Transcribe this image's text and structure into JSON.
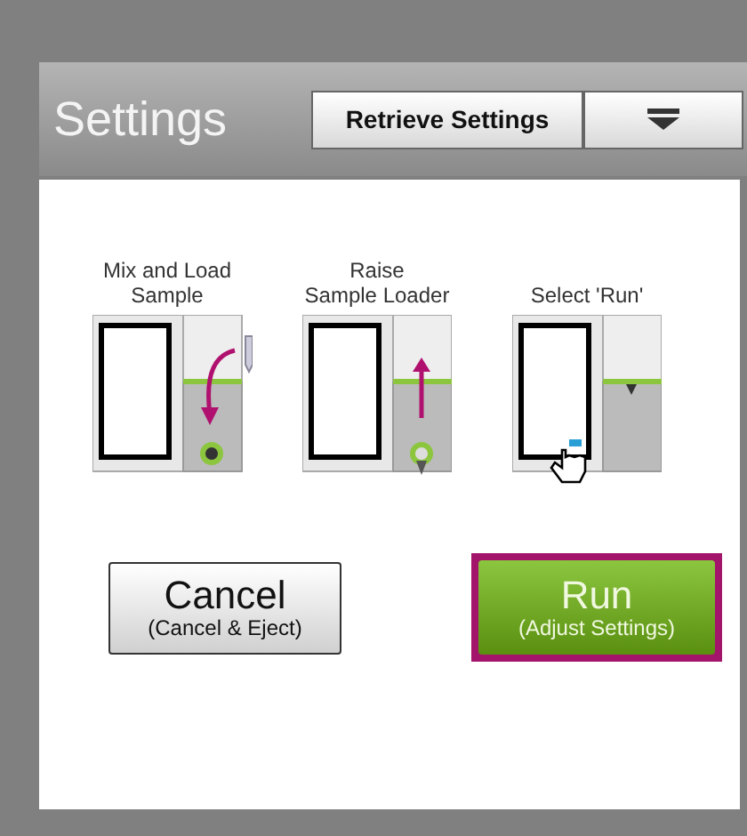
{
  "header": {
    "title": "Settings",
    "retrieve_button": "Retrieve Settings"
  },
  "steps": [
    {
      "label": "Mix and Load\nSample",
      "kind": "load"
    },
    {
      "label": "Raise\nSample Loader",
      "kind": "raise"
    },
    {
      "label": "Select 'Run'",
      "kind": "select"
    }
  ],
  "buttons": [
    {
      "kind": "cancel",
      "title": "Cancel",
      "subtitle": "(Cancel & Eject)",
      "selected": false
    },
    {
      "kind": "run",
      "title": "Run",
      "subtitle": "(Adjust Settings)",
      "selected": true
    }
  ]
}
